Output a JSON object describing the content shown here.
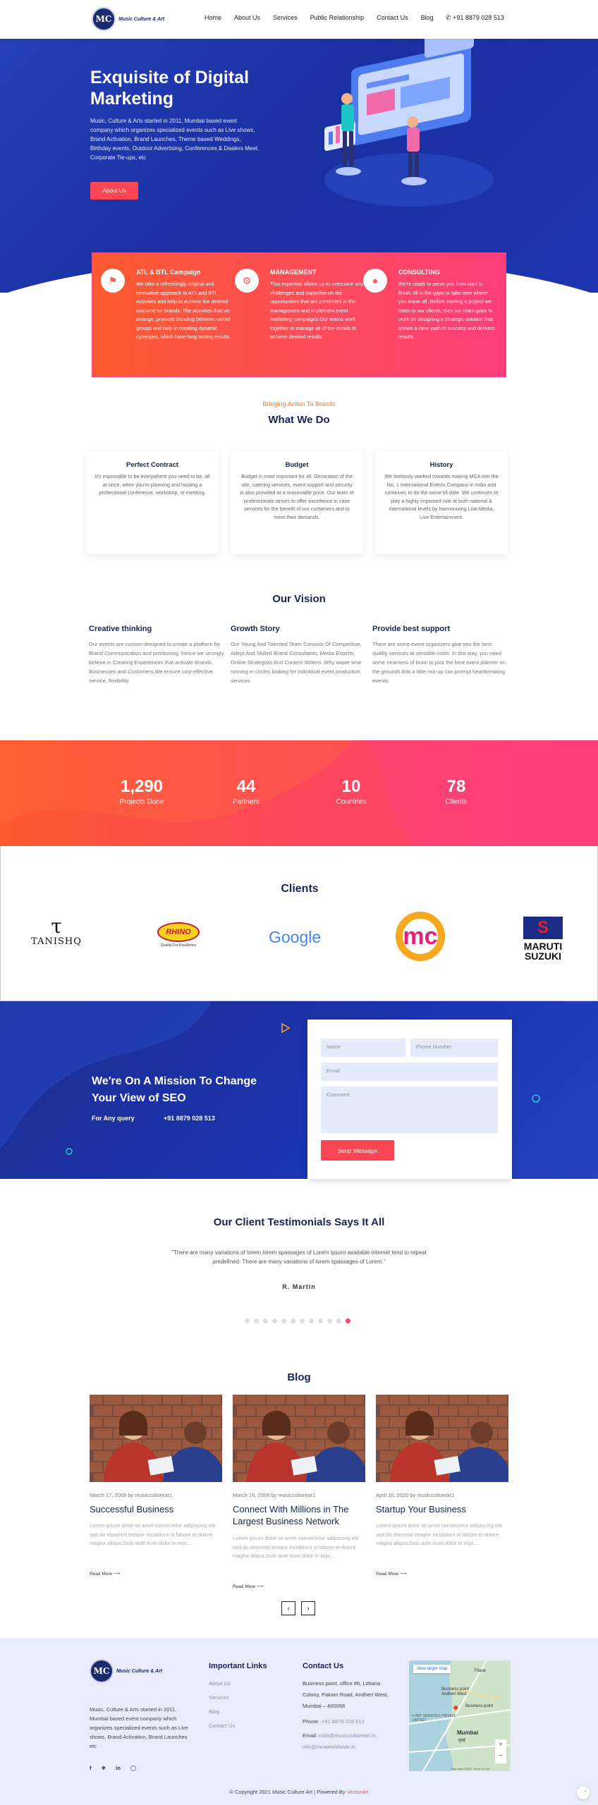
{
  "brand": {
    "name": "Music Culture & Art",
    "mark": "MC"
  },
  "nav": {
    "items": [
      "Home",
      "About Us",
      "Services",
      "Public Relationship",
      "Contact Us",
      "Blog"
    ],
    "phone": "+91 8879 028 513"
  },
  "hero": {
    "title": "Exquisite of Digital Marketing",
    "body": "Music, Culture & Arts started in 2011, Mumbai based event company which organizes specialized events such as Live shows, Brand Activation, Brand Launches, Theme based Weddings, Birthday events, Outdoor Advertising, Conferences & Dealers Meet, Corporate Tie-ups, etc",
    "button": "About Us"
  },
  "services": [
    {
      "title": "ATL & BTL Campaign",
      "icon": "megaphone-icon",
      "body": "We take a refreshingly original and innovative approach to ATL and BTL Activities and help to achieve the desired outcome for brands. The activities that we arrange, promote bonding between varied groups and help in creating dynamic synergies, which have long lasting results."
    },
    {
      "title": "MANAGEMENT",
      "icon": "management-icon",
      "body": "That expertise allows us to overcome any challenges and capitalize on the opportunities that are presented in the management and implement event marketing campaigns.Our teams work together to manage all of the details to achieve desired results."
    },
    {
      "title": "CONSULTING",
      "icon": "consulting-icon",
      "body": "We're ready to serve you from start to finish, fill in the gaps or take over where you leave off. Before starting a project we listen to our clients, then our team goes to work on designing a strategic solution that shows a clear path to success and delivers results."
    }
  ],
  "whatwedo": {
    "eyebrow": "Bringing Action To Brands",
    "title": "What We Do",
    "cards": [
      {
        "title": "Perfect Contract",
        "body": "It's impossible to be everywhere you need to be, all at once, when you're planning and hosting a professional conference, workshop, or meeting."
      },
      {
        "title": "Budget",
        "body": "Budget is most important for all. Decoration of the site, catering services, event support and security is also provided at a reasonable price. Our team of professionals strives to offer excellence in case services for the benefit of our customers and to meet their demands."
      },
      {
        "title": "History",
        "body": "We tirelessly worked towards making MCA into the No. 1 International Events Company in India and continues to do the same till date. We continues to play a highly important role at both national & international levels by harmonizing Live Media, Live Entertainment."
      }
    ]
  },
  "vision": {
    "title": "Our Vision",
    "items": [
      {
        "title": "Creative thinking",
        "body": "Our events are custom-designed to create a platform for Brand Communication and positioning, hence we strongly believe in Creating Experiences that activate Brands, Businesses and Customers.We ensure cost-effective service, flexibility."
      },
      {
        "title": "Growth Story",
        "body": "Our Young And Talented Team Consists Of Competitive, Adept And Skilled Brand Consultants, Media Experts, Online Strategists And Content Writers. Why waste time running in circles looking for individual event production services"
      },
      {
        "title": "Provide best support",
        "body": "There are some event organizers give you the best quality services at sensible costs. In this way, you need some nearness of brain to pick the best event planner on the grounds that a little mix-up can prompt heartbreaking events."
      }
    ]
  },
  "stats": [
    {
      "value": "1,290",
      "label": "Projects Done"
    },
    {
      "value": "44",
      "label": "Partners"
    },
    {
      "value": "10",
      "label": "Countries"
    },
    {
      "value": "78",
      "label": "Clients"
    }
  ],
  "clients": {
    "title": "Clients",
    "logos": [
      "TANISHQ",
      "RHINO",
      "Google",
      "mc",
      "MARUTI SUZUKI"
    ],
    "rhino_tagline": "Quality For Excellence"
  },
  "mission": {
    "title": "We're On A Mission To Change Your View of SEO",
    "query_label": "For Any query",
    "phone": "+91 8879 028 513",
    "form": {
      "name": "Name",
      "phone": "Phone Number",
      "email": "Email",
      "comment": "Comment",
      "submit": "Send Message"
    }
  },
  "testimonials": {
    "title": "Our Client Testimonials Says It All",
    "quote": "\"There are many variations of lorem lorem spassages of Lorem Ipsum available internet tend to repeat predefined. There are many variations of lorem spassages of Lorem.\"",
    "author": "R. Martin",
    "dots": 12,
    "active": 11
  },
  "blog": {
    "title": "Blog",
    "posts": [
      {
        "date": "March 17, 2008 by musicculturear1",
        "title": "Successful Business",
        "excerpt": "Lorem ipsum dolor sit amet consectetur adipiscing elit sed do eiusmod tempor incididunt ut labore et dolore magna aliqua.Duis aute irure dolor in repr....",
        "more": "Read More"
      },
      {
        "date": "March 16, 2008 by musicculturear1",
        "title": "Connect With Millions in The Largest Business Network",
        "excerpt": "Lorem ipsum dolor sit amet consectetur adipiscing elit sed do eiusmod tempor incididunt ut labore et dolore magna aliqua.Duis aute irure dolor in repr....",
        "more": "Read More"
      },
      {
        "date": "April 10, 2020 by musicculturear1",
        "title": "Startup Your Business",
        "excerpt": "Lorem ipsum dolor sit amet consectetur adipiscing elit sed do eiusmod tempor incididunt ut labore et dolore magna aliqua.Duis aute irure dolor in repr....",
        "more": "Read More"
      }
    ]
  },
  "footer": {
    "about": "Music, Culture & Arts started in 2011, Mumbai based event company which organizes specialized events such as Live shows, Brand Activation, Brand Launches etc",
    "links_title": "Important Links",
    "links": [
      "About Us",
      "Services",
      "Blog",
      "Contact Us"
    ],
    "contact_title": "Contact Us",
    "address": [
      "Business point, office #6, Lohana",
      "Colony, Palram Road, Andheri West,",
      "Mumbai – 400058"
    ],
    "phone_label": "Phone:",
    "phone": "+91 8879 028 513",
    "email_label": "Email:",
    "emails": [
      "rohit@musicculturearl.in ,",
      "info@mcaworldwide.in"
    ],
    "map": {
      "button": "View larger map",
      "pin_label": "Business point Andheri West",
      "place": "Business point",
      "area": "V ART SERVICES PRIVATE LIMITED",
      "city": "Mumbai",
      "city_local": "मुंबई",
      "north": "Thane",
      "credit": "Map data ©2021  Terms of Use"
    },
    "social": [
      "facebook-icon",
      "twitter-icon",
      "linkedin-icon",
      "instagram-icon"
    ],
    "copyright": "© Copyright 2021 Music Culture Art | Powered By",
    "powered": "VectorArt"
  }
}
